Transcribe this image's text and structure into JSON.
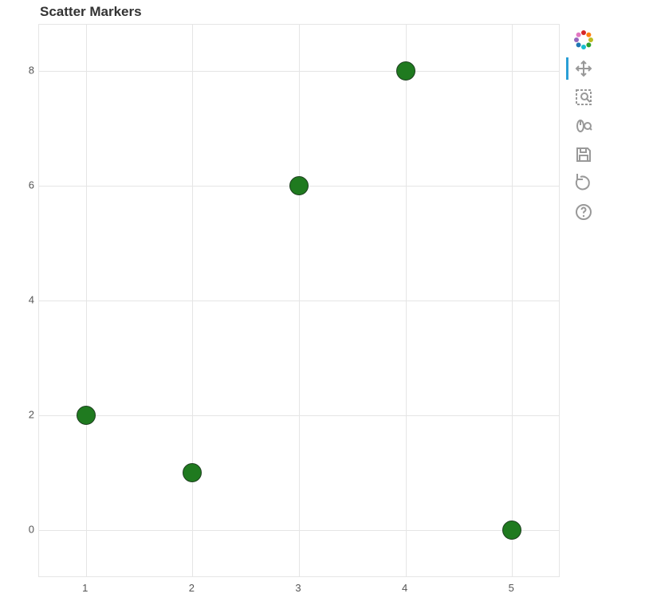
{
  "chart_data": {
    "type": "scatter",
    "title": "Scatter Markers",
    "x": [
      1,
      2,
      3,
      4,
      5
    ],
    "y": [
      2,
      1,
      6,
      8,
      0
    ],
    "xlim": [
      0.56,
      5.44
    ],
    "ylim": [
      -0.8,
      8.8
    ],
    "x_ticks": [
      1,
      2,
      3,
      4,
      5
    ],
    "y_ticks": [
      0,
      2,
      4,
      6,
      8
    ],
    "marker_color": "#1f7a1f",
    "marker_outline": "#1e4020"
  },
  "toolbar": {
    "logo": "bokeh-logo",
    "tools": [
      {
        "name": "pan",
        "icon": "move-icon",
        "active": true
      },
      {
        "name": "box-zoom",
        "icon": "box-zoom-icon",
        "active": false
      },
      {
        "name": "wheel-zoom",
        "icon": "wheel-zoom-icon",
        "active": false
      },
      {
        "name": "save",
        "icon": "save-icon",
        "active": false
      },
      {
        "name": "reset",
        "icon": "reset-icon",
        "active": false
      },
      {
        "name": "help",
        "icon": "help-icon",
        "active": false
      }
    ]
  }
}
